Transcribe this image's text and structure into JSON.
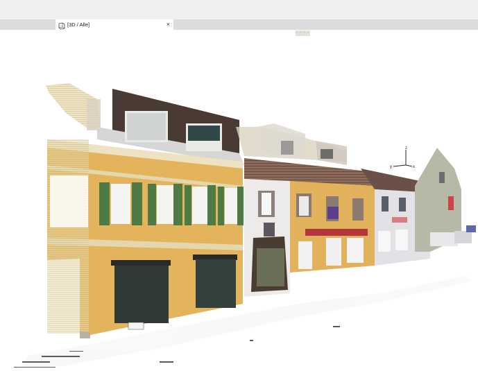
{
  "window": {
    "tab_label": "[3D / Alle]",
    "close_glyph": "×",
    "handle_glyph": "- - - -",
    "tab_icon": "3d-view-icon"
  },
  "view": {
    "type": "3d-point-cloud-street-facade",
    "axes": {
      "x": "x",
      "y": "y",
      "z": "z"
    },
    "colors": {
      "facade_yellow": "#e3b45b",
      "facade_cream": "#dcc88c",
      "shutter_green": "#4e7a45",
      "roof_dark": "#4a3a34",
      "shop_red": "#b4353a",
      "garage_dark": "#2f3a36"
    }
  }
}
